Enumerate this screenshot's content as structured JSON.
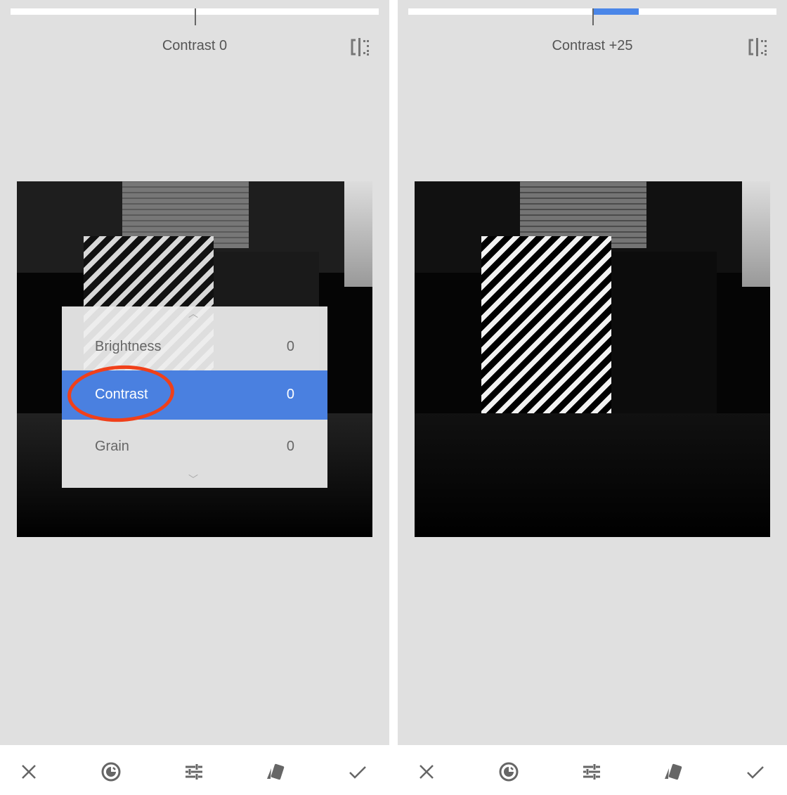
{
  "colors": {
    "accent": "#4a86e8",
    "annotation": "#f0401a"
  },
  "left": {
    "title": "Contrast 0",
    "slider_value": 0,
    "menu": {
      "items": [
        {
          "label": "Brightness",
          "value": "0"
        },
        {
          "label": "Contrast",
          "value": "0",
          "selected": true
        },
        {
          "label": "Grain",
          "value": "0"
        }
      ]
    }
  },
  "right": {
    "title": "Contrast +25",
    "slider_value": 25
  },
  "toolbar": {
    "icons": [
      "close-icon",
      "auto-adjust-icon",
      "tune-icon",
      "styles-icon",
      "check-icon"
    ]
  }
}
